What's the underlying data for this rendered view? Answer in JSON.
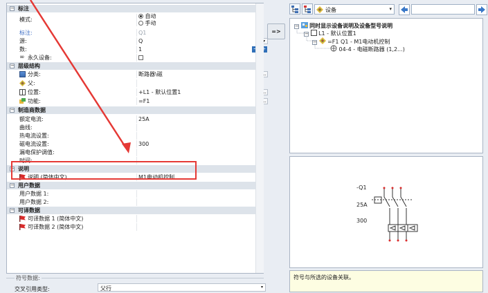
{
  "properties": {
    "annotation": {
      "title": "标注",
      "mode_label": "模式:",
      "mode_options": [
        "自动",
        "手动"
      ],
      "label_label": "标注:",
      "label_value": "Q1",
      "source_label": "源:",
      "source_value": "Q",
      "count_label": "数:",
      "count_value": "1",
      "permanent_label": "永久设备:"
    },
    "hierarchy": {
      "title": "层级结构",
      "category_label": "分类:",
      "category_value": "断路器\\磁",
      "parent_label": "父:",
      "location_label": "位置:",
      "location_value": "+L1 - 默认位置1",
      "function_label": "功能:",
      "function_value": "=F1"
    },
    "manufacturer": {
      "title": "制造商数据",
      "rated_current_label": "额定电流:",
      "rated_current_value": "25A",
      "curve_label": "曲线:",
      "thermal_label": "热电流设置:",
      "magnetic_label": "磁电流设置:",
      "magnetic_value": "300",
      "leakage_label": "漏电保护调值:",
      "time_label": "时间:"
    },
    "description": {
      "title": "说明",
      "desc_label": "说明 (简体中文)",
      "desc_value": "M1电动机控制"
    },
    "user_data": {
      "title": "用户数据",
      "user1_label": "用户数据 1:",
      "user2_label": "用户数据 2:"
    },
    "translatable": {
      "title": "可译数据",
      "t1_label": "可译数据 1 (简体中文)",
      "t2_label": "可译数据 2 (简体中文)"
    },
    "symbol_data": {
      "legend": "符号数据:",
      "crossref_label": "交叉引用类型:",
      "crossref_value": "父行"
    }
  },
  "assign_button_label": "=>",
  "toolbar": {
    "device_dropdown": "设备",
    "search_value": ""
  },
  "tree": {
    "root": "同时显示设备说明及设备型号说明",
    "location": "L1 - 默认位置1",
    "device": "=F1 Q1 - M1电动机控制",
    "part": "04-4 - 电磁断路器 (1,2...)"
  },
  "preview": {
    "tag": "-Q1",
    "rating": "25A",
    "magnetic": "300"
  },
  "desc_text": "符号与所选的设备关联。",
  "colors": {
    "highlight_box": "#e53935",
    "arrow": "#e53935",
    "section_bg": "#dde3ea",
    "note_bg": "#fdfde2"
  }
}
